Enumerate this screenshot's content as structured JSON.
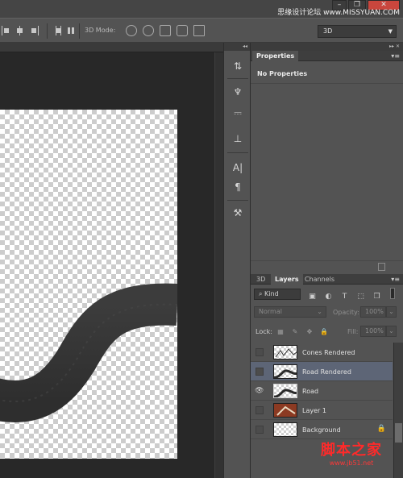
{
  "window": {
    "watermark_top": "思缘设计论坛  www.MISSYUAN.COM",
    "buttons": {
      "minimize": "–",
      "restore": "❐",
      "close": "✕"
    }
  },
  "options_bar": {
    "mode_label": "3D Mode:",
    "mode_icons": [
      "rotate-3d-icon",
      "roll-3d-icon",
      "drag-3d-icon",
      "slide-3d-icon",
      "scale-3d-icon"
    ],
    "workspace_select": "3D"
  },
  "dock": {
    "header_glyph": "◂◂",
    "buttons": [
      {
        "name": "history-icon",
        "glyph": "⇅"
      },
      {
        "name": "brush-presets-icon",
        "glyph": "♆"
      },
      {
        "name": "brush-icon",
        "glyph": "⎓"
      },
      {
        "name": "clone-source-icon",
        "glyph": "⊥"
      },
      {
        "name": "character-icon",
        "glyph": "A|"
      },
      {
        "name": "paragraph-icon",
        "glyph": "¶"
      },
      {
        "name": "tool-presets-icon",
        "glyph": "⚒"
      }
    ]
  },
  "properties_panel": {
    "header_glyph": "▸▸  ✕",
    "tab": "Properties",
    "menu": "▾≡",
    "body": "No Properties"
  },
  "layers_panel": {
    "tabs": [
      "3D",
      "Layers",
      "Channels"
    ],
    "active_tab": "Layers",
    "menu": "▾≡",
    "filter_kind": "Kind",
    "filter_icons": [
      "▣",
      "◐",
      "T",
      "⬚",
      "❒"
    ],
    "blend_mode": "Normal",
    "opacity_label": "Opacity:",
    "opacity_value": "100%",
    "lock_label": "Lock:",
    "lock_icons": [
      "▦",
      "✎",
      "✥",
      "🔒"
    ],
    "fill_label": "Fill:",
    "fill_value": "100%",
    "layers": [
      {
        "name": "Cones Rendered",
        "visible": false,
        "selected": false,
        "locked": false
      },
      {
        "name": "Road Rendered",
        "visible": false,
        "selected": true,
        "locked": false
      },
      {
        "name": "Road",
        "visible": true,
        "selected": false,
        "locked": false
      },
      {
        "name": "Layer 1",
        "visible": false,
        "selected": false,
        "locked": false
      },
      {
        "name": "Background",
        "visible": false,
        "selected": false,
        "locked": true
      }
    ]
  },
  "watermark_bottom": {
    "text": "脚本之家",
    "url": "www.jb51.net"
  },
  "colors": {
    "panel_bg": "#535353",
    "canvas_bg": "#282828",
    "selected_layer": "#5d6576",
    "watermark_red": "#ff2a2a"
  }
}
